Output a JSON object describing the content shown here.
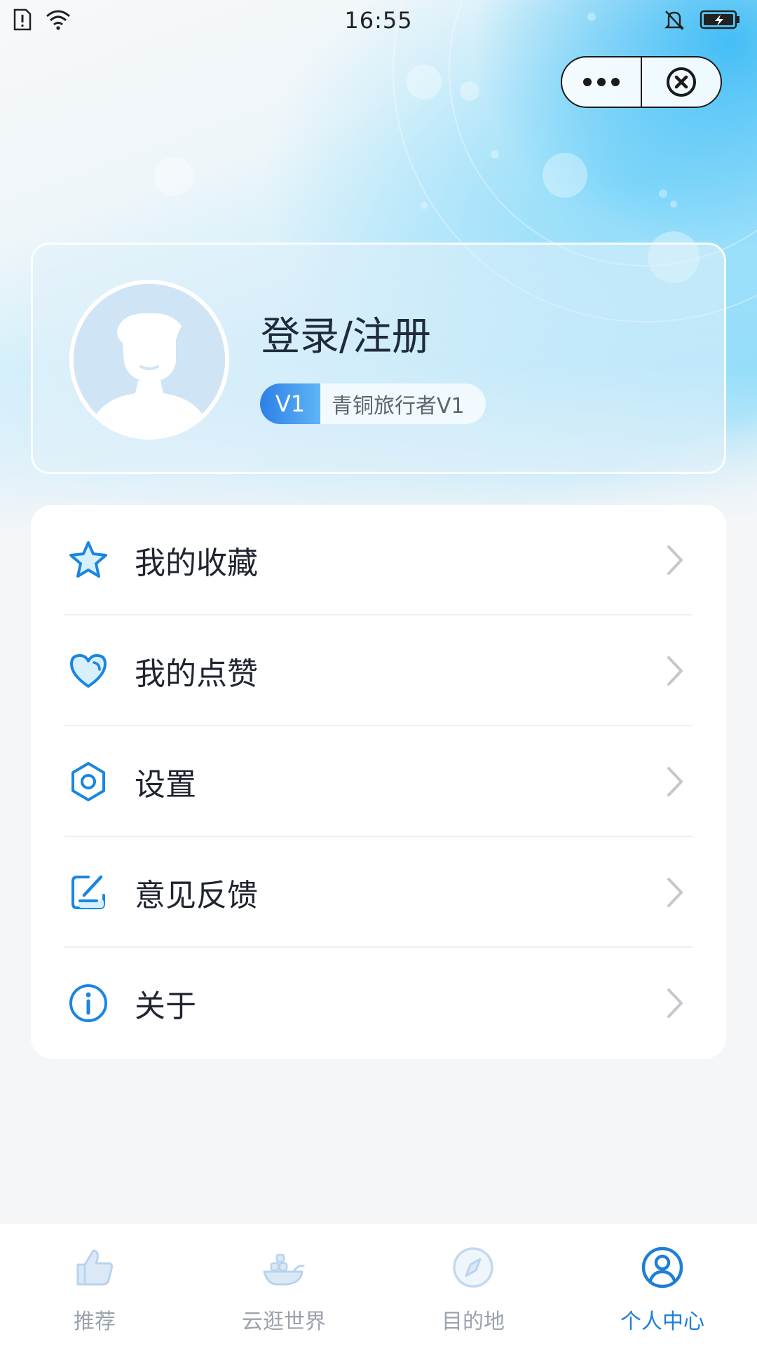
{
  "status_bar": {
    "time": "16:55"
  },
  "capsule": {
    "more_icon": "more-dots-icon",
    "close_icon": "close-circle-icon"
  },
  "profile": {
    "title": "登录/注册",
    "level_badge": "V1",
    "level_name": "青铜旅行者V1"
  },
  "menu": {
    "items": [
      {
        "label": "我的收藏",
        "icon": "star-icon"
      },
      {
        "label": "我的点赞",
        "icon": "heart-icon"
      },
      {
        "label": "设置",
        "icon": "settings-icon"
      },
      {
        "label": "意见反馈",
        "icon": "feedback-icon"
      },
      {
        "label": "关于",
        "icon": "info-icon"
      }
    ]
  },
  "tabs": [
    {
      "label": "推荐",
      "icon": "thumbs-up-icon",
      "active": false
    },
    {
      "label": "云逛世界",
      "icon": "ship-icon",
      "active": false
    },
    {
      "label": "目的地",
      "icon": "compass-icon",
      "active": false
    },
    {
      "label": "个人中心",
      "icon": "user-circle-icon",
      "active": true
    }
  ],
  "colors": {
    "accent": "#1e7fd6",
    "icon_blue": "#1a86e0",
    "inactive_tab": "#9aa3ad",
    "sky": "#8fdcfa"
  }
}
